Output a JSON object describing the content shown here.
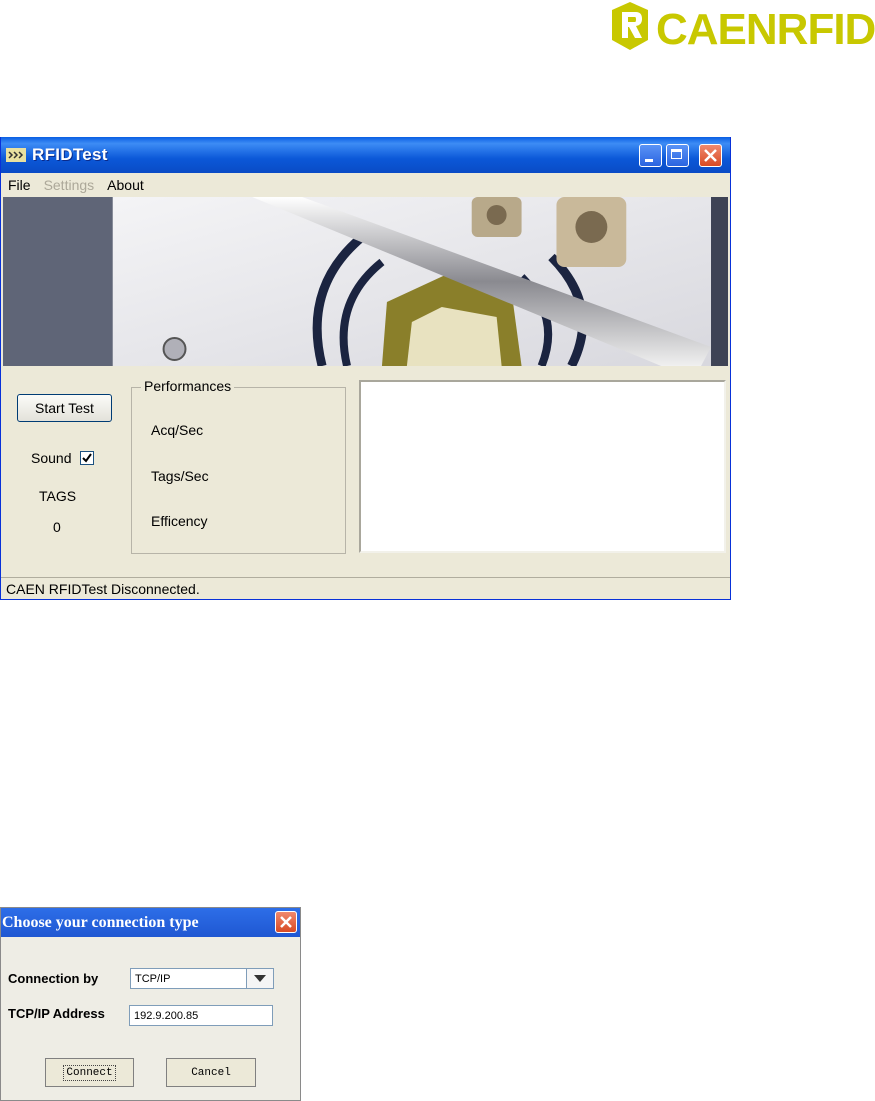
{
  "logo": {
    "text": "CAENRFID",
    "color": "#c8c800"
  },
  "window": {
    "title": "RFIDTest",
    "menu": [
      "File",
      "Settings",
      "About"
    ],
    "start_button": "Start Test",
    "sound_label": "Sound",
    "sound_checked": true,
    "tags_label": "TAGS",
    "tags_count": "0",
    "performances": {
      "legend": "Performances",
      "rows": [
        "Acq/Sec",
        "Tags/Sec",
        "Efficency"
      ]
    },
    "status": "CAEN RFIDTest Disconnected."
  },
  "dialog": {
    "title": "Choose your connection type",
    "connection_label": "Connection by",
    "connection_value": "TCP/IP",
    "address_label": "TCP/IP Address",
    "address_value": "192.9.200.85",
    "connect_button": "Connect",
    "cancel_button": "Cancel"
  }
}
